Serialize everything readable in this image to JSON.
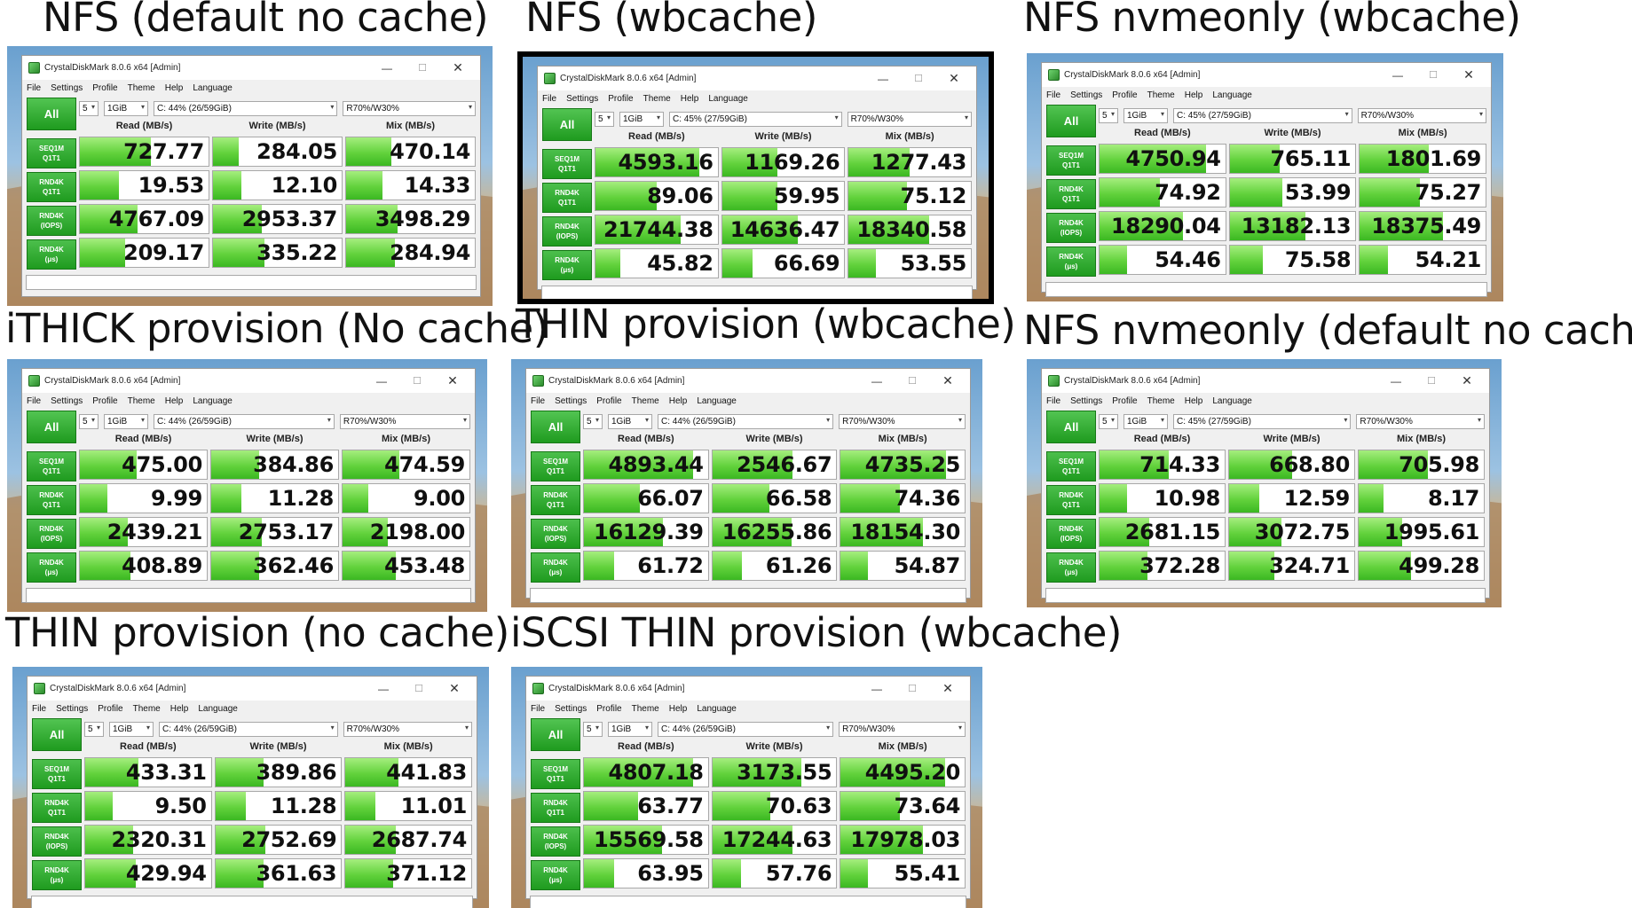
{
  "app": {
    "title": "CrystalDiskMark 8.0.6 x64 [Admin]",
    "menu": [
      "File",
      "Settings",
      "Profile",
      "Theme",
      "Help",
      "Language"
    ],
    "all_label": "All",
    "columns": [
      "Read (MB/s)",
      "Write (MB/s)",
      "Mix (MB/s)"
    ],
    "row_labels": [
      [
        "SEQ1M",
        "Q1T1"
      ],
      [
        "RND4K",
        "Q1T1"
      ],
      [
        "RND4K",
        "(IOPS)"
      ],
      [
        "RND4K",
        "(μs)"
      ]
    ],
    "window_controls": [
      "minimize-icon",
      "maximize-icon",
      "close-icon"
    ],
    "accent_color": "#3bb822"
  },
  "panels": [
    {
      "caption": "NFS (default no cache)",
      "count": "5",
      "size": "1GiB",
      "drive": "C: 44% (26/59GiB)",
      "mix": "R70%/W30%",
      "rows": [
        {
          "values": [
            "727.77",
            "284.05",
            "470.14"
          ],
          "fill": [
            0.55,
            0.2,
            0.35
          ]
        },
        {
          "values": [
            "19.53",
            "12.10",
            "14.33"
          ],
          "fill": [
            0.3,
            0.22,
            0.28
          ]
        },
        {
          "values": [
            "4767.09",
            "2953.37",
            "3498.29"
          ],
          "fill": [
            0.45,
            0.38,
            0.4
          ]
        },
        {
          "values": [
            "209.17",
            "335.22",
            "284.94"
          ],
          "fill": [
            0.35,
            0.4,
            0.38
          ]
        }
      ]
    },
    {
      "caption": "NFS (wbcache)",
      "count": "5",
      "size": "1GiB",
      "drive": "C: 45% (27/59GiB)",
      "mix": "R70%/W30%",
      "rows": [
        {
          "values": [
            "4593.16",
            "1169.26",
            "1277.43"
          ],
          "fill": [
            0.85,
            0.45,
            0.5
          ]
        },
        {
          "values": [
            "89.06",
            "59.95",
            "75.12"
          ],
          "fill": [
            0.5,
            0.45,
            0.48
          ]
        },
        {
          "values": [
            "21744.38",
            "14636.47",
            "18340.58"
          ],
          "fill": [
            0.7,
            0.62,
            0.66
          ]
        },
        {
          "values": [
            "45.82",
            "66.69",
            "53.55"
          ],
          "fill": [
            0.2,
            0.25,
            0.22
          ]
        }
      ]
    },
    {
      "caption": "NFS nvmeonly (wbcache)",
      "count": "5",
      "size": "1GiB",
      "drive": "C: 45% (27/59GiB)",
      "mix": "R70%/W30%",
      "rows": [
        {
          "values": [
            "4750.94",
            "765.11",
            "1801.69"
          ],
          "fill": [
            0.85,
            0.4,
            0.55
          ]
        },
        {
          "values": [
            "74.92",
            "53.99",
            "75.27"
          ],
          "fill": [
            0.48,
            0.42,
            0.48
          ]
        },
        {
          "values": [
            "18290.04",
            "13182.13",
            "18375.49"
          ],
          "fill": [
            0.66,
            0.6,
            0.66
          ]
        },
        {
          "values": [
            "54.46",
            "75.58",
            "54.21"
          ],
          "fill": [
            0.22,
            0.26,
            0.22
          ]
        }
      ]
    },
    {
      "caption": "iTHICK provision (No cache)",
      "count": "5",
      "size": "1GiB",
      "drive": "C: 44% (26/59GiB)",
      "mix": "R70%/W30%",
      "rows": [
        {
          "values": [
            "475.00",
            "384.86",
            "474.59"
          ],
          "fill": [
            0.45,
            0.38,
            0.45
          ]
        },
        {
          "values": [
            "9.99",
            "11.28",
            "9.00"
          ],
          "fill": [
            0.22,
            0.24,
            0.2
          ]
        },
        {
          "values": [
            "2439.21",
            "2753.17",
            "2198.00"
          ],
          "fill": [
            0.38,
            0.4,
            0.36
          ]
        },
        {
          "values": [
            "408.89",
            "362.46",
            "453.48"
          ],
          "fill": [
            0.4,
            0.38,
            0.42
          ]
        }
      ]
    },
    {
      "caption": "THIN provision (wbcache)",
      "count": "5",
      "size": "1GiB",
      "drive": "C: 44% (26/59GiB)",
      "mix": "R70%/W30%",
      "rows": [
        {
          "values": [
            "4893.44",
            "2546.67",
            "4735.25"
          ],
          "fill": [
            0.88,
            0.65,
            0.85
          ]
        },
        {
          "values": [
            "66.07",
            "66.58",
            "74.36"
          ],
          "fill": [
            0.45,
            0.46,
            0.48
          ]
        },
        {
          "values": [
            "16129.39",
            "16255.86",
            "18154.30"
          ],
          "fill": [
            0.64,
            0.64,
            0.66
          ]
        },
        {
          "values": [
            "61.72",
            "61.26",
            "54.87"
          ],
          "fill": [
            0.24,
            0.24,
            0.22
          ]
        }
      ]
    },
    {
      "caption": "NFS nvmeonly (default no cache)",
      "count": "5",
      "size": "1GiB",
      "drive": "C: 45% (27/59GiB)",
      "mix": "R70%/W30%",
      "rows": [
        {
          "values": [
            "714.33",
            "668.80",
            "705.98"
          ],
          "fill": [
            0.55,
            0.5,
            0.55
          ]
        },
        {
          "values": [
            "10.98",
            "12.59",
            "8.17"
          ],
          "fill": [
            0.22,
            0.24,
            0.2
          ]
        },
        {
          "values": [
            "2681.15",
            "3072.75",
            "1995.61"
          ],
          "fill": [
            0.4,
            0.42,
            0.35
          ]
        },
        {
          "values": [
            "372.28",
            "324.71",
            "499.28"
          ],
          "fill": [
            0.38,
            0.36,
            0.42
          ]
        }
      ]
    },
    {
      "caption": "THIN provision (no cache)",
      "count": "5",
      "size": "1GiB",
      "drive": "C: 44% (26/59GiB)",
      "mix": "R70%/W30%",
      "rows": [
        {
          "values": [
            "433.31",
            "389.86",
            "441.83"
          ],
          "fill": [
            0.42,
            0.38,
            0.42
          ]
        },
        {
          "values": [
            "9.50",
            "11.28",
            "11.01"
          ],
          "fill": [
            0.22,
            0.24,
            0.24
          ]
        },
        {
          "values": [
            "2320.31",
            "2752.69",
            "2687.74"
          ],
          "fill": [
            0.38,
            0.4,
            0.4
          ]
        },
        {
          "values": [
            "429.94",
            "361.63",
            "371.12"
          ],
          "fill": [
            0.4,
            0.38,
            0.38
          ]
        }
      ]
    },
    {
      "caption": "iSCSI THIN provision (wbcache)",
      "count": "5",
      "size": "1GiB",
      "drive": "C: 44% (26/59GiB)",
      "mix": "R70%/W30%",
      "rows": [
        {
          "values": [
            "4807.18",
            "3173.55",
            "4495.20"
          ],
          "fill": [
            0.88,
            0.72,
            0.84
          ]
        },
        {
          "values": [
            "63.77",
            "70.63",
            "73.64"
          ],
          "fill": [
            0.44,
            0.47,
            0.48
          ]
        },
        {
          "values": [
            "15569.58",
            "17244.63",
            "17978.03"
          ],
          "fill": [
            0.63,
            0.65,
            0.66
          ]
        },
        {
          "values": [
            "63.95",
            "57.76",
            "55.41"
          ],
          "fill": [
            0.24,
            0.23,
            0.22
          ]
        }
      ]
    }
  ]
}
